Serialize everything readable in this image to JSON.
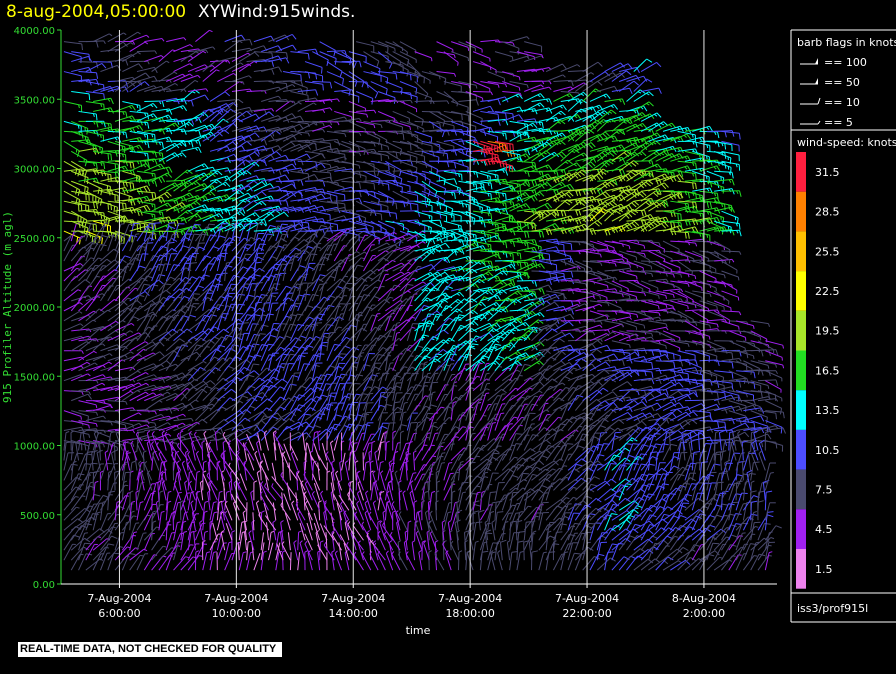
{
  "title": {
    "datetime": "8-aug-2004,05:00:00",
    "product": "XYWind:915winds."
  },
  "quality_note": "REAL-TIME DATA, NOT CHECKED FOR QUALITY",
  "station": "iss3/prof915l",
  "legend": {
    "barb_title": "barb flags in knots",
    "barbs": [
      {
        "label": "== 100",
        "knots": 100
      },
      {
        "label": "== 50",
        "knots": 50
      },
      {
        "label": "== 10",
        "knots": 10
      },
      {
        "label": "== 5",
        "knots": 5
      }
    ],
    "speed_title": "wind-speed: knots"
  },
  "colorbar": [
    {
      "label": "31.5",
      "color": "#ff1f3f"
    },
    {
      "label": "28.5",
      "color": "#ff8000"
    },
    {
      "label": "25.5",
      "color": "#ffbf00"
    },
    {
      "label": "22.5",
      "color": "#ffff00"
    },
    {
      "label": "19.5",
      "color": "#a8e62a"
    },
    {
      "label": "16.5",
      "color": "#22dd22"
    },
    {
      "label": "13.5",
      "color": "#00ffff"
    },
    {
      "label": "10.5",
      "color": "#4d4dff"
    },
    {
      "label": "7.5",
      "color": "#4a4a6e"
    },
    {
      "label": "4.5",
      "color": "#a020f0"
    },
    {
      "label": "1.5",
      "color": "#ee82ee"
    }
  ],
  "chart_data": {
    "type": "wind-barb time-height",
    "xlabel": "time",
    "ylabel": "915 Profiler Altitude (m agl)",
    "ylim": [
      0,
      4000
    ],
    "yticks": [
      "0.00",
      "500.00",
      "1000.00",
      "1500.00",
      "2000.00",
      "2500.00",
      "3000.00",
      "3500.00",
      "4000.00"
    ],
    "xlim": [
      "7-Aug-2004 04:00",
      "8-Aug-2004 04:30"
    ],
    "xticks": [
      {
        "line1": "7-Aug-2004",
        "line2": "6:00:00",
        "hours": 6
      },
      {
        "line1": "7-Aug-2004",
        "line2": "10:00:00",
        "hours": 10
      },
      {
        "line1": "7-Aug-2004",
        "line2": "14:00:00",
        "hours": 14
      },
      {
        "line1": "7-Aug-2004",
        "line2": "18:00:00",
        "hours": 18
      },
      {
        "line1": "7-Aug-2004",
        "line2": "22:00:00",
        "hours": 22
      },
      {
        "line1": "8-Aug-2004",
        "line2": "2:00:00",
        "hours": 26
      }
    ],
    "vertical_time_lines": true,
    "barb_speed_units": "knots",
    "approx_fields": {
      "below_1000m": "mostly 4.5-7.5 kt, southerly to southwesterly, up to 13.5 kt after 21:00",
      "1000_2500m": "mostly 7.5-10.5 kt, westerly, 13.5-19.5 kt near 17:00-19:00",
      "2500_3500m": "13.5-19.5 kt westerly, isolated 31.5 kt near 18:30 at 3100 m",
      "above_3500m": "mostly 7.5-13.5 kt, sparse"
    }
  }
}
